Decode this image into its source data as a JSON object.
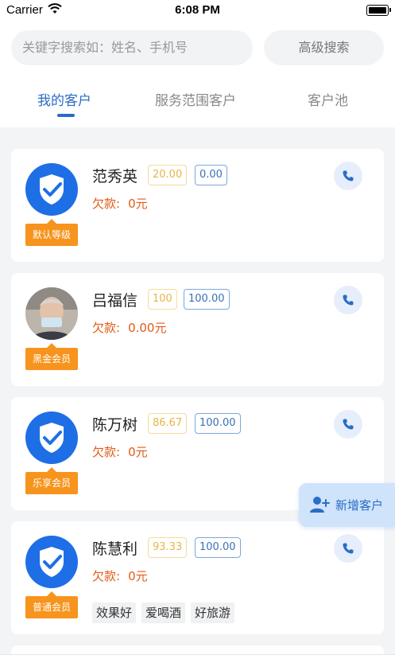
{
  "status_bar": {
    "carrier": "Carrier",
    "time": "6:08 PM"
  },
  "search": {
    "placeholder": "关键字搜索如：姓名、手机号",
    "advanced_label": "高级搜索"
  },
  "tabs": [
    {
      "label": "我的客户",
      "active": true
    },
    {
      "label": "服务范围客户",
      "active": false
    },
    {
      "label": "客户池",
      "active": false
    }
  ],
  "customers": [
    {
      "name": "范秀英",
      "tag_a": "20.00",
      "tag_b": "0.00",
      "debt_label": "欠款:",
      "debt_value": "0元",
      "level": "默认等级",
      "avatar": "shield-icon"
    },
    {
      "name": "吕福信",
      "tag_a": "100",
      "tag_b": "100.00",
      "debt_label": "欠款:",
      "debt_value": "0.00元",
      "level": "黑金会员",
      "avatar": "photo"
    },
    {
      "name": "陈万树",
      "tag_a": "86.67",
      "tag_b": "100.00",
      "debt_label": "欠款:",
      "debt_value": "0元",
      "level": "乐享会员",
      "avatar": "shield-icon"
    },
    {
      "name": "陈慧利",
      "tag_a": "93.33",
      "tag_b": "100.00",
      "debt_label": "欠款:",
      "debt_value": "0元",
      "level": "普通会员",
      "avatar": "shield-icon",
      "interests": [
        "效果好",
        "爱喝酒",
        "好旅游"
      ]
    }
  ],
  "add_customer": {
    "label": "新增客户"
  },
  "colors": {
    "primary": "#2a6cc7",
    "level_badge": "#f7941d",
    "debt": "#e05a14",
    "avatar_bg": "#1e6fe6"
  }
}
